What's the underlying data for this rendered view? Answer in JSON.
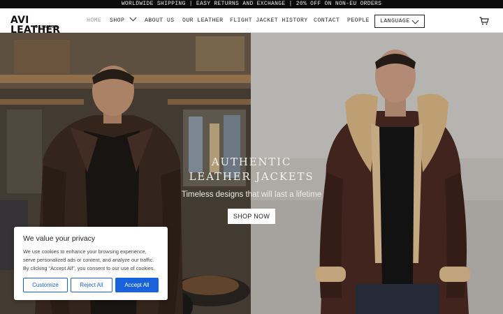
{
  "announcement": "WORLDWIDE SHIPPING | EASY RETURNS AND EXCHANGE | 20% OFF ON NON-EU ORDERS",
  "logo": {
    "main": "AVI LEATHER",
    "sub": "DENMARK"
  },
  "nav": {
    "items": [
      {
        "label": "HOME",
        "active": true
      },
      {
        "label": "SHOP"
      },
      {
        "label": "ABOUT US"
      },
      {
        "label": "OUR LEATHER"
      },
      {
        "label": "FLIGHT JACKET HISTORY"
      },
      {
        "label": "CONTACT"
      },
      {
        "label": "PEOPLE"
      }
    ],
    "language_label": "LANGUAGE",
    "cart_icon": "cart-icon"
  },
  "hero": {
    "title_line1": "AUTHENTIC",
    "title_line2": "LEATHER JACKETS",
    "subtitle": "Timeless designs that will last a lifetime",
    "cta_label": "SHOP NOW"
  },
  "cookie": {
    "title": "We value your privacy",
    "text": "We use cookies to enhance your browsing experience, serve personalized ads or content, and analyze our traffic. By clicking \"Accept All\", you consent to our use of cookies.",
    "customize_label": "Customize",
    "reject_label": "Reject All",
    "accept_label": "Accept All"
  },
  "colors": {
    "accent": "#1863dc",
    "announcement_bg": "#0b0b0b",
    "header_text": "#2a2a2a"
  }
}
